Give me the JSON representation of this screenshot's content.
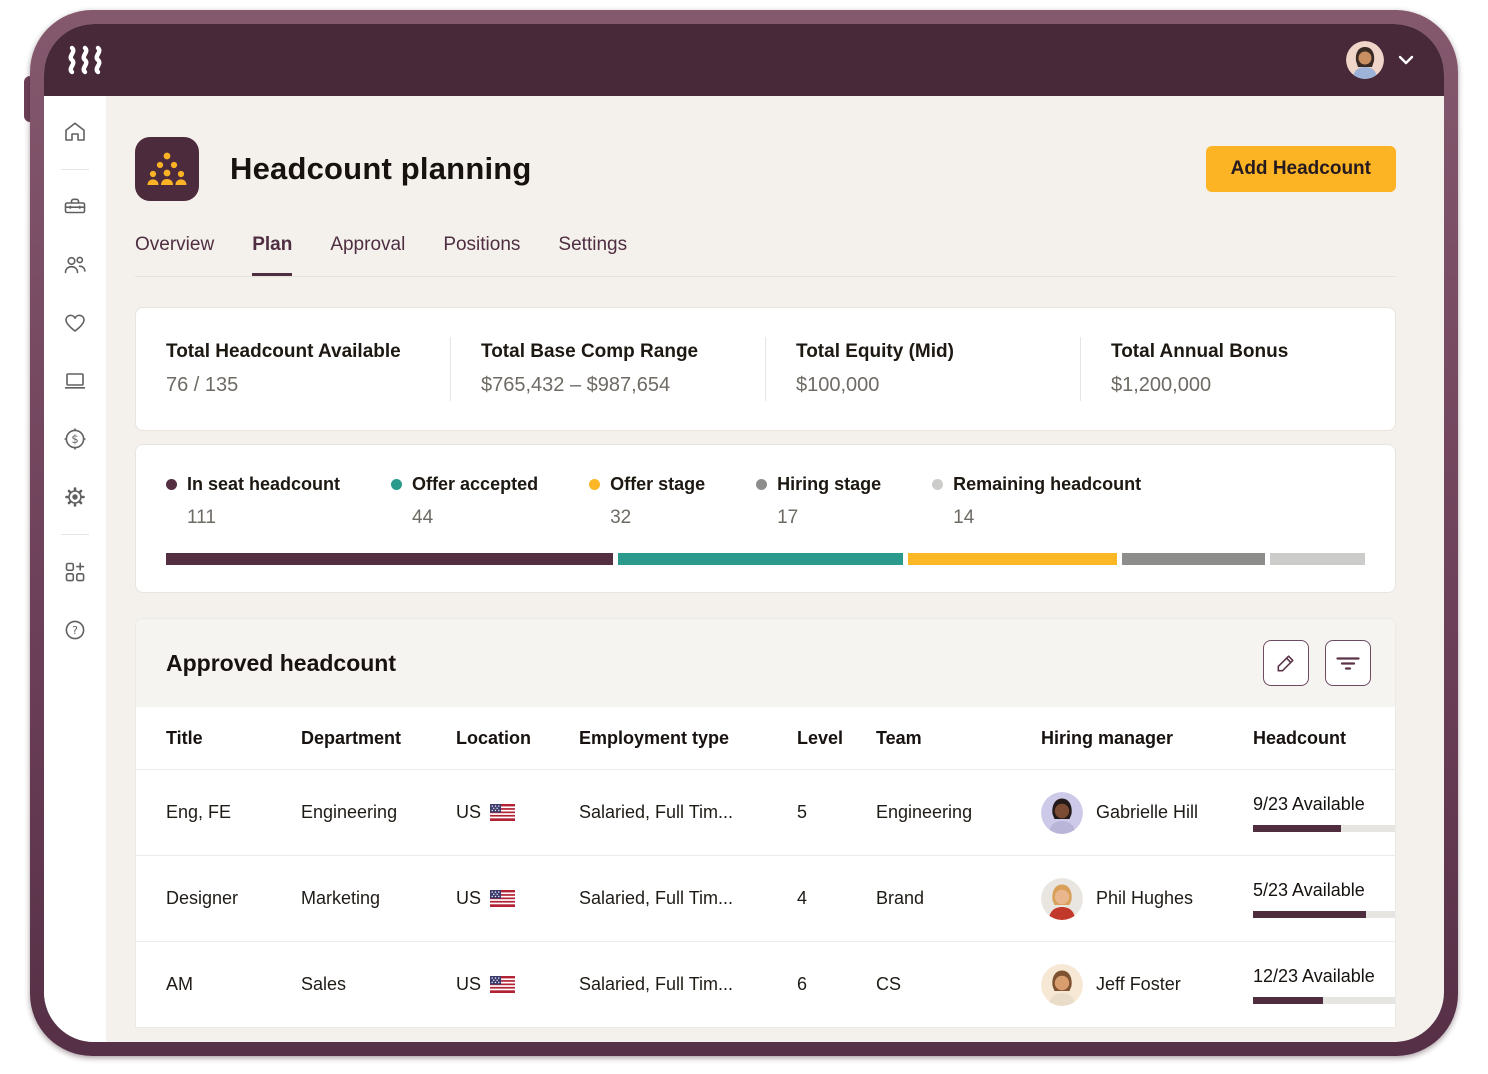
{
  "header": {
    "title": "Headcount planning",
    "add_button": "Add Headcount"
  },
  "tabs": [
    {
      "label": "Overview",
      "active": false
    },
    {
      "label": "Plan",
      "active": true
    },
    {
      "label": "Approval",
      "active": false
    },
    {
      "label": "Positions",
      "active": false
    },
    {
      "label": "Settings",
      "active": false
    }
  ],
  "stats": [
    {
      "label": "Total Headcount Available",
      "value": "76 / 135"
    },
    {
      "label": "Total Base Comp Range",
      "value": "$765,432 – $987,654"
    },
    {
      "label": "Total Equity (Mid)",
      "value": "$100,000"
    },
    {
      "label": "Total Annual Bonus",
      "value": "$1,200,000"
    }
  ],
  "chart_data": {
    "type": "bar",
    "title": "Headcount pipeline",
    "categories": [
      "In seat headcount",
      "Offer accepted",
      "Offer stage",
      "Hiring stage",
      "Remaining headcount"
    ],
    "values": [
      111,
      44,
      32,
      17,
      14
    ],
    "colors": [
      "#532f41",
      "#299a8c",
      "#fbb725",
      "#8d8d8b",
      "#cccccb"
    ]
  },
  "legend": {
    "items": [
      {
        "label": "In seat headcount",
        "value": "111",
        "color": "#532f41",
        "width": "37.5%"
      },
      {
        "label": "Offer accepted",
        "value": "44",
        "color": "#299a8c",
        "width": "24%"
      },
      {
        "label": "Offer stage",
        "value": "32",
        "color": "#fbb725",
        "width": "17.5%"
      },
      {
        "label": "Hiring stage",
        "value": "17",
        "color": "#8d8d8b",
        "width": "12%"
      },
      {
        "label": "Remaining headcount",
        "value": "14",
        "color": "#cccccb",
        "width": "8%"
      }
    ]
  },
  "table": {
    "title": "Approved headcount",
    "columns": [
      "Title",
      "Department",
      "Location",
      "Employment type",
      "Level",
      "Team",
      "Hiring manager",
      "Headcount"
    ],
    "rows": [
      {
        "title": "Eng, FE",
        "department": "Engineering",
        "location": "US",
        "employment": "Salaried, Full Tim...",
        "level": "5",
        "team": "Engineering",
        "manager": "Gabrielle Hill",
        "headcount": "9/23 Available",
        "fill": "61%",
        "avatar": {
          "bg": "#cdc9e8",
          "skin": "#7b4b33",
          "hair": "#241a1a",
          "shirt": "#b9b5d8"
        }
      },
      {
        "title": "Designer",
        "department": "Marketing",
        "location": "US",
        "employment": "Salaried, Full Tim...",
        "level": "4",
        "team": "Brand",
        "manager": "Phil Hughes",
        "headcount": "5/23 Available",
        "fill": "78%",
        "avatar": {
          "bg": "#e9e5e1",
          "skin": "#eab68e",
          "hair": "#d8a058",
          "shirt": "#c2392b"
        }
      },
      {
        "title": "AM",
        "department": "Sales",
        "location": "US",
        "employment": "Salaried, Full Tim...",
        "level": "6",
        "team": "CS",
        "manager": "Jeff Foster",
        "headcount": "12/23 Available",
        "fill": "48%",
        "avatar": {
          "bg": "#f6e8d4",
          "skin": "#d99e6e",
          "hair": "#7e5230",
          "shirt": "#e9ddc9"
        }
      }
    ]
  },
  "topbar_avatar": {
    "bg": "#f0d5c9",
    "skin": "#c98f60",
    "hair": "#3a2a24",
    "shirt": "#9db4d8"
  }
}
